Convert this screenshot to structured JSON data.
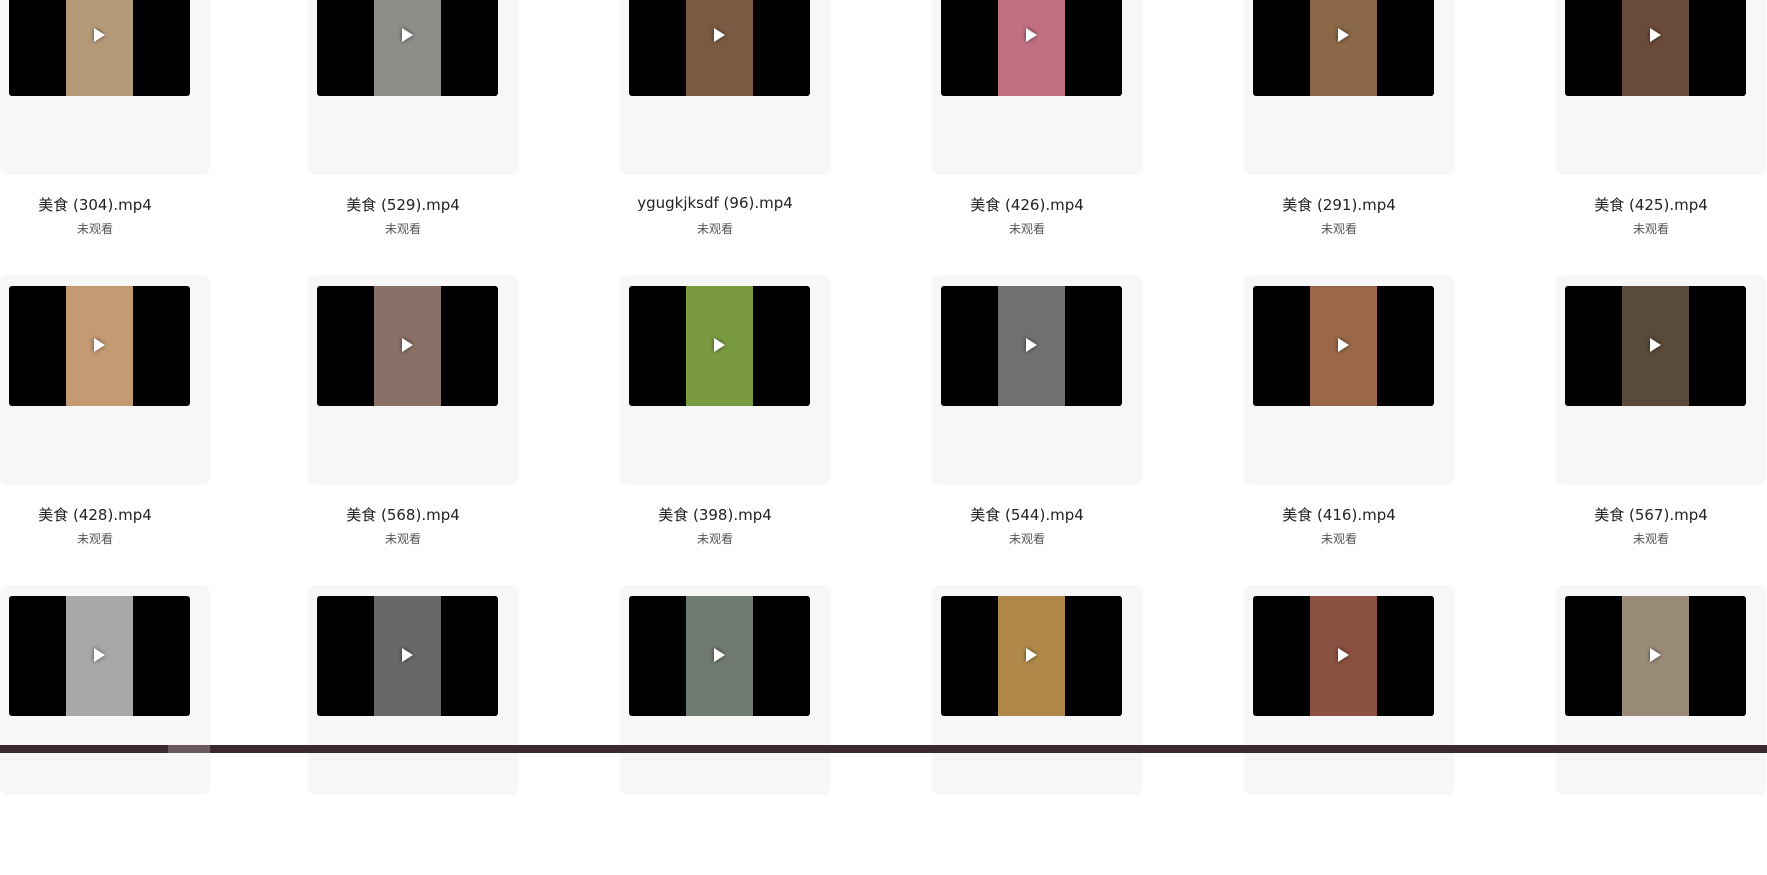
{
  "videos": [
    {
      "name": "美食 (304).mp4",
      "status": "未观看",
      "tint": "#b49a78"
    },
    {
      "name": "美食 (529).mp4",
      "status": "未观看",
      "tint": "#8c8c88"
    },
    {
      "name": "ygugkjksdf (96).mp4",
      "status": "未观看",
      "tint": "#7a5a40"
    },
    {
      "name": "美食 (426).mp4",
      "status": "未观看",
      "tint": "#c07080"
    },
    {
      "name": "美食 (291).mp4",
      "status": "未观看",
      "tint": "#8a6848"
    },
    {
      "name": "美食 (425).mp4",
      "status": "未观看",
      "tint": "#6a4a38"
    },
    {
      "name": "美食 (428).mp4",
      "status": "未观看",
      "tint": "#c49a72"
    },
    {
      "name": "美食 (568).mp4",
      "status": "未观看",
      "tint": "#8a7066"
    },
    {
      "name": "美食 (398).mp4",
      "status": "未观看",
      "tint": "#7a9a40"
    },
    {
      "name": "美食 (544).mp4",
      "status": "未观看",
      "tint": "#707070"
    },
    {
      "name": "美食 (416).mp4",
      "status": "未观看",
      "tint": "#9a6848"
    },
    {
      "name": "美食 (567).mp4",
      "status": "未观看",
      "tint": "#5a4a3a"
    },
    {
      "name": "",
      "status": "",
      "tint": "#a8a8a8"
    },
    {
      "name": "",
      "status": "",
      "tint": "#686868"
    },
    {
      "name": "",
      "status": "",
      "tint": "#707a70"
    },
    {
      "name": "",
      "status": "",
      "tint": "#b08848"
    },
    {
      "name": "",
      "status": "",
      "tint": "#8a5040"
    },
    {
      "name": "",
      "status": "",
      "tint": "#9a8a78"
    }
  ]
}
